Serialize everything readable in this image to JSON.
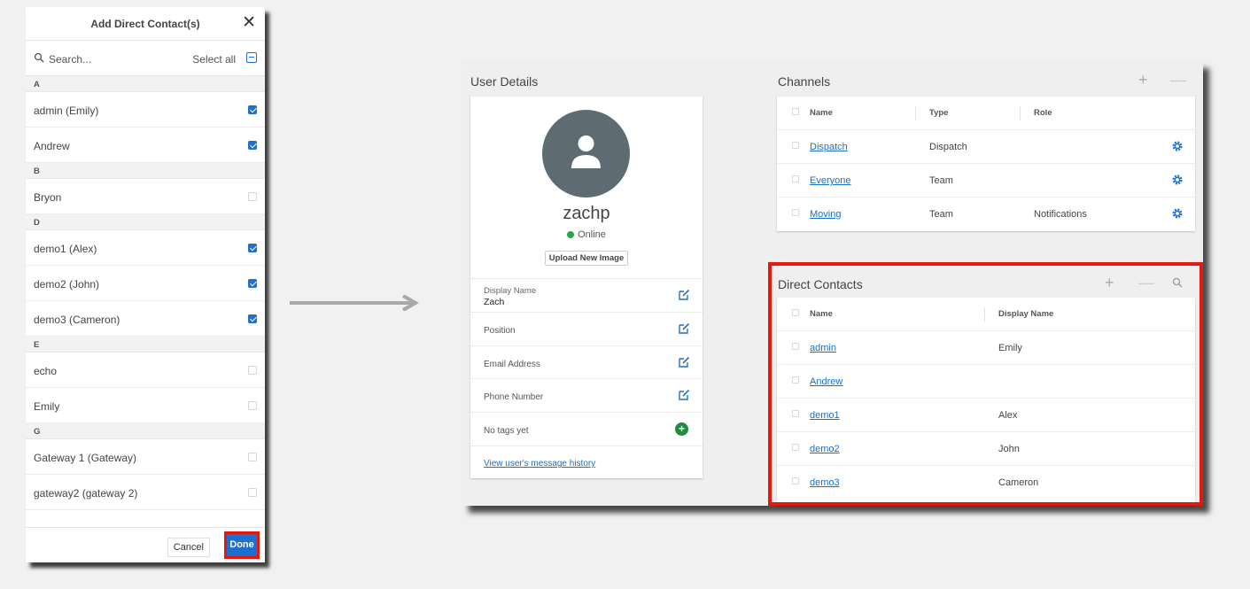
{
  "dialog": {
    "title": "Add Direct Contact(s)",
    "close": "✕",
    "search_placeholder": "Search...",
    "select_all": "Select all",
    "groups": [
      {
        "letter": "A",
        "items": [
          {
            "label": "admin (Emily)",
            "checked": true
          },
          {
            "label": "Andrew",
            "checked": true
          }
        ]
      },
      {
        "letter": "B",
        "items": [
          {
            "label": "Bryon",
            "checked": false
          }
        ]
      },
      {
        "letter": "D",
        "items": [
          {
            "label": "demo1 (Alex)",
            "checked": true
          },
          {
            "label": "demo2 (John)",
            "checked": true
          },
          {
            "label": "demo3 (Cameron)",
            "checked": true
          }
        ]
      },
      {
        "letter": "E",
        "items": [
          {
            "label": "echo",
            "checked": false
          },
          {
            "label": "Emily",
            "checked": false
          }
        ]
      },
      {
        "letter": "G",
        "items": [
          {
            "label": "Gateway 1 (Gateway)",
            "checked": false
          },
          {
            "label": "gateway2 (gateway 2)",
            "checked": false
          }
        ]
      }
    ],
    "cancel": "Cancel",
    "done": "Done"
  },
  "user_details": {
    "section_title": "User Details",
    "username": "zachp",
    "status": "Online",
    "upload": "Upload New Image",
    "display_name_label": "Display Name",
    "display_name_value": "Zach",
    "position_label": "Position",
    "email_label": "Email Address",
    "phone_label": "Phone Number",
    "tags_label": "No tags yet",
    "history_link": "View user's message history"
  },
  "channels": {
    "section_title": "Channels",
    "headers": [
      "Name",
      "Type",
      "Role"
    ],
    "rows": [
      {
        "name": "Dispatch",
        "type": "Dispatch",
        "role": ""
      },
      {
        "name": "Everyone",
        "type": "Team",
        "role": ""
      },
      {
        "name": "Moving",
        "type": "Team",
        "role": "Notifications"
      }
    ]
  },
  "direct_contacts": {
    "section_title": "Direct Contacts",
    "headers": [
      "Name",
      "Display Name"
    ],
    "rows": [
      {
        "name": "admin",
        "display": "Emily"
      },
      {
        "name": "Andrew",
        "display": ""
      },
      {
        "name": "demo1",
        "display": "Alex"
      },
      {
        "name": "demo2",
        "display": "John"
      },
      {
        "name": "demo3",
        "display": "Cameron"
      }
    ]
  },
  "colors": {
    "accent": "#1f6fd1",
    "highlight": "#e3180f",
    "online": "#28a745",
    "link": "#1a6fc7",
    "avatar": "#5e6b72"
  },
  "icons": [
    "search-icon",
    "close-icon",
    "minus-box-icon",
    "edit-icon",
    "gear-icon",
    "plus-icon",
    "minus-icon",
    "user-icon",
    "add-tag-icon",
    "arrow-right-icon"
  ]
}
